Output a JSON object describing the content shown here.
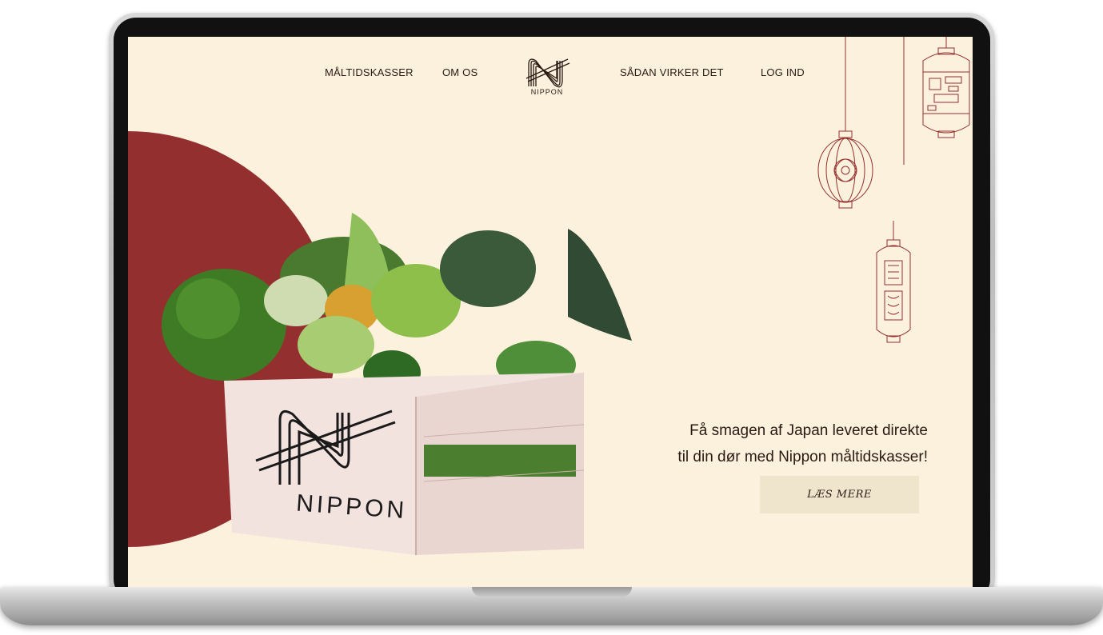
{
  "nav": {
    "items": [
      {
        "label": "MÅLTIDSKASSER"
      },
      {
        "label": "OM OS"
      },
      {
        "label": "SÅDAN VIRKER DET"
      },
      {
        "label": "LOG IND"
      }
    ],
    "logo_text": "NIPPON"
  },
  "hero": {
    "box_brand": "NIPPON",
    "tagline_line1": "Få smagen af Japan leveret direkte",
    "tagline_line2": "til din dør med Nippon måltidskasser!",
    "cta_label": "LÆS MERE"
  },
  "colors": {
    "background": "#fcf1dc",
    "accent_red": "#942f2f",
    "button_bg": "#efe4cc",
    "text": "#2a1a14"
  }
}
